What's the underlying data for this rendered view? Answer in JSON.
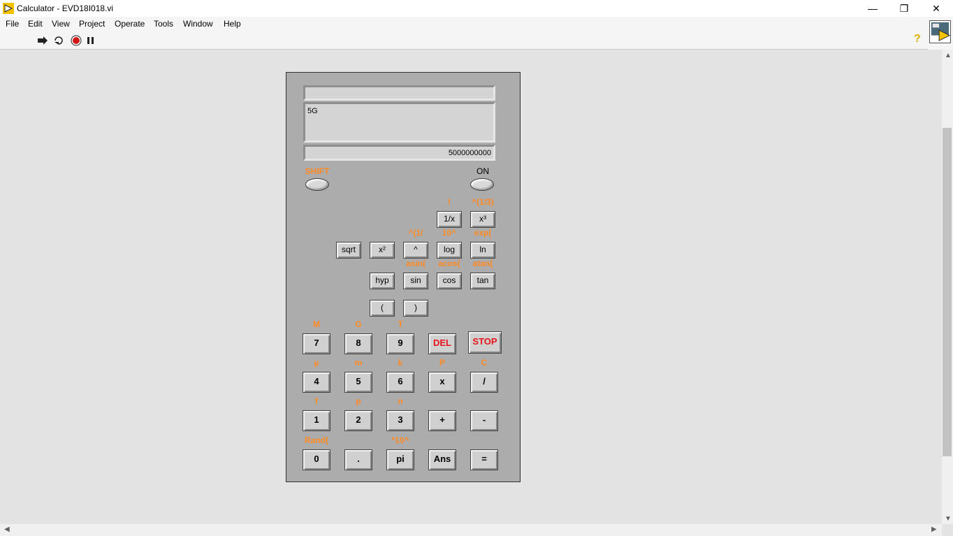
{
  "window": {
    "title": "Calculator - EVD18I018.vi",
    "minimize": "—",
    "restore": "❐",
    "close": "✕"
  },
  "menu": [
    "File",
    "Edit",
    "View",
    "Project",
    "Operate",
    "Tools",
    "Window",
    "Help"
  ],
  "toolbar": {
    "help": "?"
  },
  "calc": {
    "display_top": "",
    "display_expr": "5G",
    "display_result": "5000000000",
    "shift_label": "SHIFT",
    "on_label": "ON",
    "sci": [
      {
        "key": "1/x",
        "alt": "!",
        "name": "reciprocal"
      },
      {
        "key": "x³",
        "alt": "^(1/3)",
        "name": "cube"
      },
      {
        "key": "sqrt",
        "alt": "",
        "name": "sqrt"
      },
      {
        "key": "x²",
        "alt": "",
        "name": "square"
      },
      {
        "key": "^",
        "alt": "^(1/",
        "name": "power"
      },
      {
        "key": "log",
        "alt": "10^",
        "name": "log"
      },
      {
        "key": "ln",
        "alt": "exp(",
        "name": "ln"
      },
      {
        "key": "hyp",
        "alt": "",
        "name": "hyp"
      },
      {
        "key": "sin",
        "alt": "asin(",
        "name": "sin"
      },
      {
        "key": "cos",
        "alt": "acos(",
        "name": "cos"
      },
      {
        "key": "tan",
        "alt": "atan(",
        "name": "tan"
      },
      {
        "key": "(",
        "alt": "",
        "name": "open-paren"
      },
      {
        "key": ")",
        "alt": "",
        "name": "close-paren"
      }
    ],
    "main": [
      {
        "key": "7",
        "alt": "M",
        "name": "digit-7"
      },
      {
        "key": "8",
        "alt": "G",
        "name": "digit-8"
      },
      {
        "key": "9",
        "alt": "T",
        "name": "digit-9"
      },
      {
        "key": "DEL",
        "alt": "",
        "name": "del"
      },
      {
        "key": "STOP",
        "alt": "",
        "name": "stop"
      },
      {
        "key": "4",
        "alt": "µ",
        "name": "digit-4"
      },
      {
        "key": "5",
        "alt": "m",
        "name": "digit-5"
      },
      {
        "key": "6",
        "alt": "k",
        "name": "digit-6"
      },
      {
        "key": "x",
        "alt": "P",
        "name": "multiply"
      },
      {
        "key": "/",
        "alt": "C",
        "name": "divide"
      },
      {
        "key": "1",
        "alt": "f",
        "name": "digit-1"
      },
      {
        "key": "2",
        "alt": "p",
        "name": "digit-2"
      },
      {
        "key": "3",
        "alt": "n",
        "name": "digit-3"
      },
      {
        "key": "+",
        "alt": "",
        "name": "plus"
      },
      {
        "key": "-",
        "alt": "",
        "name": "minus"
      },
      {
        "key": "0",
        "alt": "Rand(",
        "name": "digit-0"
      },
      {
        "key": ".",
        "alt": "",
        "name": "decimal"
      },
      {
        "key": "pi",
        "alt": "*10^",
        "name": "pi"
      },
      {
        "key": "Ans",
        "alt": "",
        "name": "ans"
      },
      {
        "key": "=",
        "alt": "",
        "name": "equals"
      }
    ]
  }
}
